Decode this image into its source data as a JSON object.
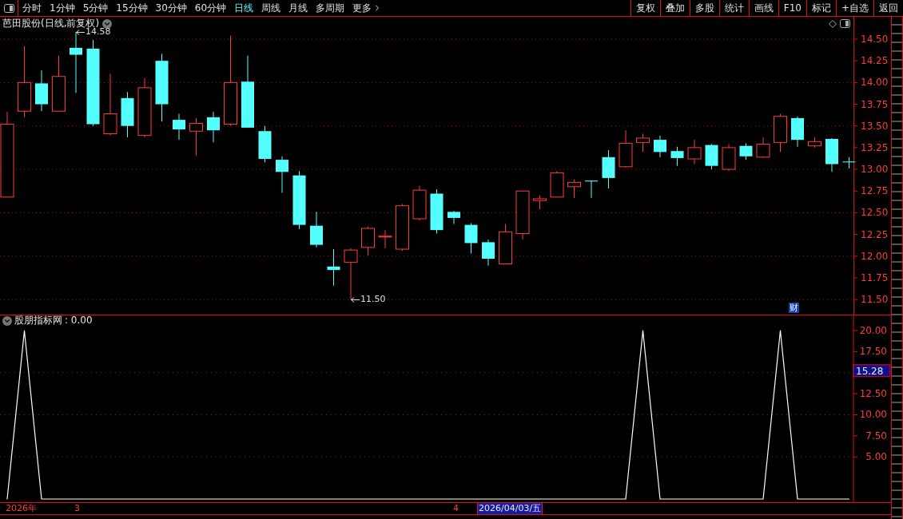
{
  "toolbar": {
    "periods": [
      {
        "label": "分时",
        "selected": false
      },
      {
        "label": "1分钟",
        "selected": false
      },
      {
        "label": "5分钟",
        "selected": false
      },
      {
        "label": "15分钟",
        "selected": false
      },
      {
        "label": "30分钟",
        "selected": false
      },
      {
        "label": "60分钟",
        "selected": false
      },
      {
        "label": "日线",
        "selected": true
      },
      {
        "label": "周线",
        "selected": false
      },
      {
        "label": "月线",
        "selected": false
      },
      {
        "label": "多周期",
        "selected": false
      },
      {
        "label": "更多",
        "selected": false
      }
    ],
    "actions": [
      "复权",
      "叠加",
      "多股",
      "统计",
      "画线",
      "F10",
      "标记",
      "+自选",
      "返回"
    ]
  },
  "main_chart": {
    "title": "芭田股份(日线,前复权)",
    "badge": "财",
    "axis_labels": [
      "14.50",
      "14.25",
      "14.00",
      "13.75",
      "13.50",
      "13.25",
      "13.00",
      "12.75",
      "12.50",
      "12.25",
      "12.00",
      "11.75",
      "11.50"
    ],
    "price_labels": [
      "14.58",
      "11.50"
    ]
  },
  "indicator": {
    "value_text": ": 0.00",
    "cursor_value": "15.28",
    "chart_data": {
      "type": "line",
      "ylim": [
        -0.38,
        21.8
      ],
      "grid": true,
      "yticks": [
        {
          "value": 20,
          "label": "20.00"
        },
        {
          "value": 17.5,
          "label": "17.50"
        },
        {
          "value": 12.5,
          "label": "12.50"
        },
        {
          "value": 10,
          "label": "10.00"
        },
        {
          "value": 7.5,
          "label": "7.50"
        },
        {
          "value": 5,
          "label": "5.00"
        }
      ],
      "series": [
        {
          "name": "股朋指标网",
          "color": "#ffffff",
          "values": [
            0,
            20,
            0,
            0,
            0,
            0,
            0,
            0,
            0,
            0,
            0,
            0,
            0,
            0,
            0,
            0,
            0,
            0,
            0,
            0,
            0,
            0,
            0,
            0,
            0,
            0,
            0,
            0,
            0,
            0,
            0,
            0,
            0,
            0,
            0,
            0,
            0,
            20,
            0,
            0,
            0,
            0,
            0,
            0,
            0,
            20,
            0,
            0,
            0,
            0
          ]
        }
      ]
    }
  },
  "time_axis": [
    {
      "label": "2026年",
      "selected": false
    },
    {
      "label": "3",
      "selected": false
    },
    {
      "label": "4",
      "selected": false
    },
    {
      "label": "2026/04/03/五",
      "selected": true
    }
  ]
}
